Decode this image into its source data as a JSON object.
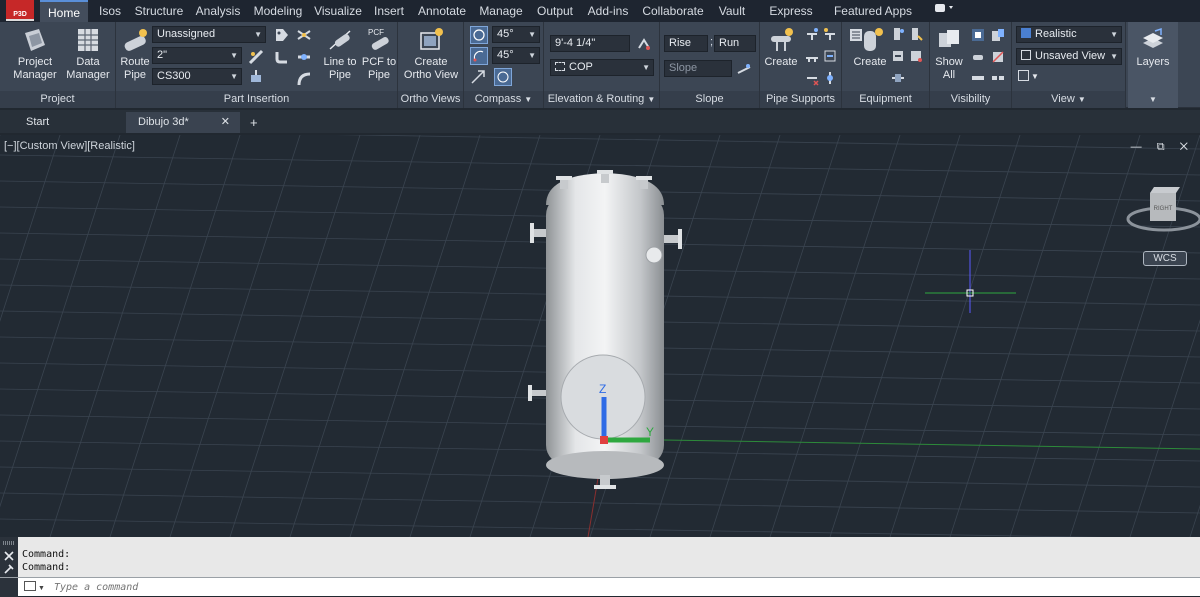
{
  "app": {
    "badge": "P3D"
  },
  "ribbon_tabs": [
    "Home",
    "Isos",
    "Structure",
    "Analysis",
    "Modeling",
    "Visualize",
    "Insert",
    "Annotate",
    "Manage",
    "Output",
    "Add-ins",
    "Collaborate",
    "Vault",
    "Express Tools",
    "Featured Apps"
  ],
  "panels": {
    "project": {
      "title": "Project",
      "project_manager": "Project\nManager",
      "data_manager": "Data\nManager"
    },
    "part_insertion": {
      "title": "Part Insertion",
      "route_pipe": "Route\nPipe",
      "line_to_pipe": "Line to\nPipe",
      "pcf_to_pipe": "PCF to\nPipe",
      "pcf_badge": "PCF",
      "spec": "Unassigned",
      "size": "2\"",
      "material": "CS300"
    },
    "ortho": {
      "title": "Ortho Views",
      "create": "Create\nOrtho View"
    },
    "compass": {
      "title": "Compass",
      "angle1": "45°",
      "angle2": "45°"
    },
    "elevation": {
      "title": "Elevation & Routing",
      "elev": "9'-4 1/4\"",
      "cop": "COP"
    },
    "slope": {
      "title": "Slope",
      "rise": "Rise",
      "run": "Run",
      "slope": "Slope",
      "sep": ";"
    },
    "pipe_supports": {
      "title": "Pipe Supports",
      "create": "Create"
    },
    "equipment": {
      "title": "Equipment",
      "create": "Create"
    },
    "visibility": {
      "title": "Visibility",
      "show_all": "Show\nAll"
    },
    "view": {
      "title": "View",
      "visual_style": "Realistic",
      "named_view": "Unsaved View"
    },
    "layers": {
      "title": "Layers"
    }
  },
  "doc_tabs": [
    {
      "label": "Start"
    },
    {
      "label": "Dibujo 3d*",
      "close": "✕"
    }
  ],
  "new_tab": "+",
  "viewport": {
    "label": "[−][Custom View][Realistic]",
    "viewcube_face": "RIGHT",
    "wcs": "WCS",
    "window_controls": "— ⧉ ✕"
  },
  "ucs": {
    "z": "Z",
    "y": "Y"
  },
  "command": {
    "history": [
      "Command:",
      "Command:"
    ],
    "placeholder": "Type a command"
  },
  "colors": {
    "ribbon": "#3c4654",
    "viewport": "#222a33",
    "accent": "#5a8fd8"
  }
}
